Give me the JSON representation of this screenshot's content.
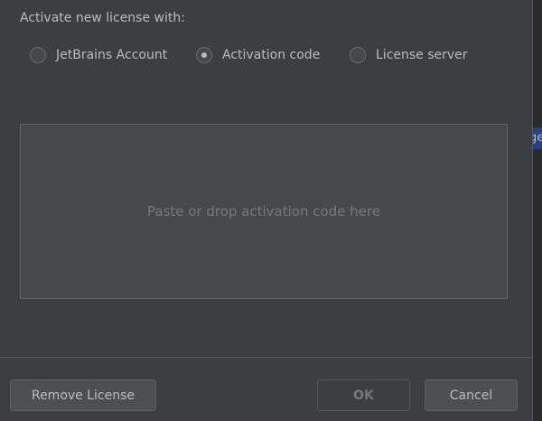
{
  "activation": {
    "title": "Activate new license with:",
    "options": [
      {
        "label": "JetBrains Account",
        "selected": false
      },
      {
        "label": "Activation code",
        "selected": true
      },
      {
        "label": "License server",
        "selected": false
      }
    ]
  },
  "code_area": {
    "placeholder": "Paste or drop activation code here"
  },
  "footer": {
    "remove_license_label": "Remove License",
    "ok_label": "OK",
    "cancel_label": "Cancel"
  },
  "side_panel": {
    "fragment_text": "ge"
  },
  "colors": {
    "background": "#3c3f41",
    "text": "#bbbbbb",
    "placeholder": "#787878",
    "field_background": "#45494a",
    "accent_tag": "#214283"
  }
}
